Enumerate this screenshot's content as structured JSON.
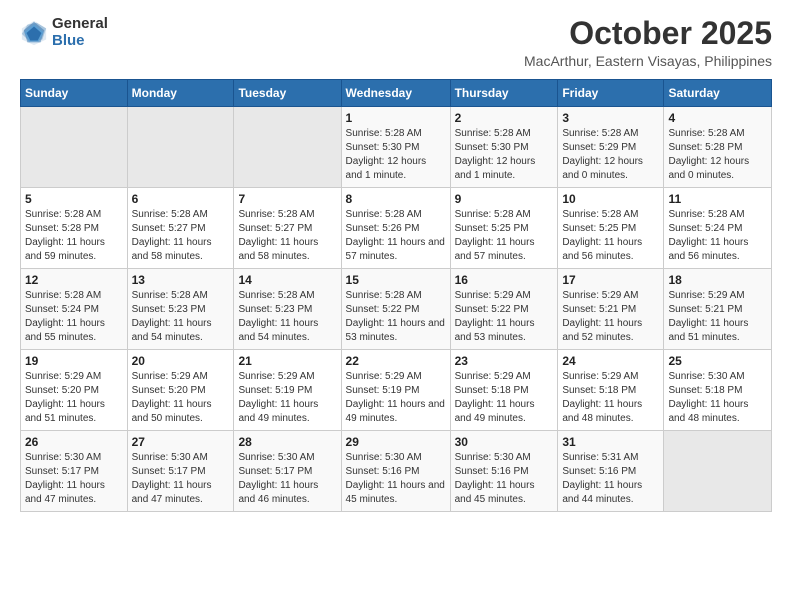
{
  "logo": {
    "general": "General",
    "blue": "Blue"
  },
  "title": "October 2025",
  "location": "MacArthur, Eastern Visayas, Philippines",
  "days_header": [
    "Sunday",
    "Monday",
    "Tuesday",
    "Wednesday",
    "Thursday",
    "Friday",
    "Saturday"
  ],
  "weeks": [
    [
      {
        "num": "",
        "sunrise": "",
        "sunset": "",
        "daylight": "",
        "empty": true
      },
      {
        "num": "",
        "sunrise": "",
        "sunset": "",
        "daylight": "",
        "empty": true
      },
      {
        "num": "",
        "sunrise": "",
        "sunset": "",
        "daylight": "",
        "empty": true
      },
      {
        "num": "1",
        "sunrise": "Sunrise: 5:28 AM",
        "sunset": "Sunset: 5:30 PM",
        "daylight": "Daylight: 12 hours and 1 minute."
      },
      {
        "num": "2",
        "sunrise": "Sunrise: 5:28 AM",
        "sunset": "Sunset: 5:30 PM",
        "daylight": "Daylight: 12 hours and 1 minute."
      },
      {
        "num": "3",
        "sunrise": "Sunrise: 5:28 AM",
        "sunset": "Sunset: 5:29 PM",
        "daylight": "Daylight: 12 hours and 0 minutes."
      },
      {
        "num": "4",
        "sunrise": "Sunrise: 5:28 AM",
        "sunset": "Sunset: 5:28 PM",
        "daylight": "Daylight: 12 hours and 0 minutes."
      }
    ],
    [
      {
        "num": "5",
        "sunrise": "Sunrise: 5:28 AM",
        "sunset": "Sunset: 5:28 PM",
        "daylight": "Daylight: 11 hours and 59 minutes."
      },
      {
        "num": "6",
        "sunrise": "Sunrise: 5:28 AM",
        "sunset": "Sunset: 5:27 PM",
        "daylight": "Daylight: 11 hours and 58 minutes."
      },
      {
        "num": "7",
        "sunrise": "Sunrise: 5:28 AM",
        "sunset": "Sunset: 5:27 PM",
        "daylight": "Daylight: 11 hours and 58 minutes."
      },
      {
        "num": "8",
        "sunrise": "Sunrise: 5:28 AM",
        "sunset": "Sunset: 5:26 PM",
        "daylight": "Daylight: 11 hours and 57 minutes."
      },
      {
        "num": "9",
        "sunrise": "Sunrise: 5:28 AM",
        "sunset": "Sunset: 5:25 PM",
        "daylight": "Daylight: 11 hours and 57 minutes."
      },
      {
        "num": "10",
        "sunrise": "Sunrise: 5:28 AM",
        "sunset": "Sunset: 5:25 PM",
        "daylight": "Daylight: 11 hours and 56 minutes."
      },
      {
        "num": "11",
        "sunrise": "Sunrise: 5:28 AM",
        "sunset": "Sunset: 5:24 PM",
        "daylight": "Daylight: 11 hours and 56 minutes."
      }
    ],
    [
      {
        "num": "12",
        "sunrise": "Sunrise: 5:28 AM",
        "sunset": "Sunset: 5:24 PM",
        "daylight": "Daylight: 11 hours and 55 minutes."
      },
      {
        "num": "13",
        "sunrise": "Sunrise: 5:28 AM",
        "sunset": "Sunset: 5:23 PM",
        "daylight": "Daylight: 11 hours and 54 minutes."
      },
      {
        "num": "14",
        "sunrise": "Sunrise: 5:28 AM",
        "sunset": "Sunset: 5:23 PM",
        "daylight": "Daylight: 11 hours and 54 minutes."
      },
      {
        "num": "15",
        "sunrise": "Sunrise: 5:28 AM",
        "sunset": "Sunset: 5:22 PM",
        "daylight": "Daylight: 11 hours and 53 minutes."
      },
      {
        "num": "16",
        "sunrise": "Sunrise: 5:29 AM",
        "sunset": "Sunset: 5:22 PM",
        "daylight": "Daylight: 11 hours and 53 minutes."
      },
      {
        "num": "17",
        "sunrise": "Sunrise: 5:29 AM",
        "sunset": "Sunset: 5:21 PM",
        "daylight": "Daylight: 11 hours and 52 minutes."
      },
      {
        "num": "18",
        "sunrise": "Sunrise: 5:29 AM",
        "sunset": "Sunset: 5:21 PM",
        "daylight": "Daylight: 11 hours and 51 minutes."
      }
    ],
    [
      {
        "num": "19",
        "sunrise": "Sunrise: 5:29 AM",
        "sunset": "Sunset: 5:20 PM",
        "daylight": "Daylight: 11 hours and 51 minutes."
      },
      {
        "num": "20",
        "sunrise": "Sunrise: 5:29 AM",
        "sunset": "Sunset: 5:20 PM",
        "daylight": "Daylight: 11 hours and 50 minutes."
      },
      {
        "num": "21",
        "sunrise": "Sunrise: 5:29 AM",
        "sunset": "Sunset: 5:19 PM",
        "daylight": "Daylight: 11 hours and 49 minutes."
      },
      {
        "num": "22",
        "sunrise": "Sunrise: 5:29 AM",
        "sunset": "Sunset: 5:19 PM",
        "daylight": "Daylight: 11 hours and 49 minutes."
      },
      {
        "num": "23",
        "sunrise": "Sunrise: 5:29 AM",
        "sunset": "Sunset: 5:18 PM",
        "daylight": "Daylight: 11 hours and 49 minutes."
      },
      {
        "num": "24",
        "sunrise": "Sunrise: 5:29 AM",
        "sunset": "Sunset: 5:18 PM",
        "daylight": "Daylight: 11 hours and 48 minutes."
      },
      {
        "num": "25",
        "sunrise": "Sunrise: 5:30 AM",
        "sunset": "Sunset: 5:18 PM",
        "daylight": "Daylight: 11 hours and 48 minutes."
      }
    ],
    [
      {
        "num": "26",
        "sunrise": "Sunrise: 5:30 AM",
        "sunset": "Sunset: 5:17 PM",
        "daylight": "Daylight: 11 hours and 47 minutes."
      },
      {
        "num": "27",
        "sunrise": "Sunrise: 5:30 AM",
        "sunset": "Sunset: 5:17 PM",
        "daylight": "Daylight: 11 hours and 47 minutes."
      },
      {
        "num": "28",
        "sunrise": "Sunrise: 5:30 AM",
        "sunset": "Sunset: 5:17 PM",
        "daylight": "Daylight: 11 hours and 46 minutes."
      },
      {
        "num": "29",
        "sunrise": "Sunrise: 5:30 AM",
        "sunset": "Sunset: 5:16 PM",
        "daylight": "Daylight: 11 hours and 45 minutes."
      },
      {
        "num": "30",
        "sunrise": "Sunrise: 5:30 AM",
        "sunset": "Sunset: 5:16 PM",
        "daylight": "Daylight: 11 hours and 45 minutes."
      },
      {
        "num": "31",
        "sunrise": "Sunrise: 5:31 AM",
        "sunset": "Sunset: 5:16 PM",
        "daylight": "Daylight: 11 hours and 44 minutes."
      },
      {
        "num": "",
        "sunrise": "",
        "sunset": "",
        "daylight": "",
        "empty": true
      }
    ]
  ]
}
